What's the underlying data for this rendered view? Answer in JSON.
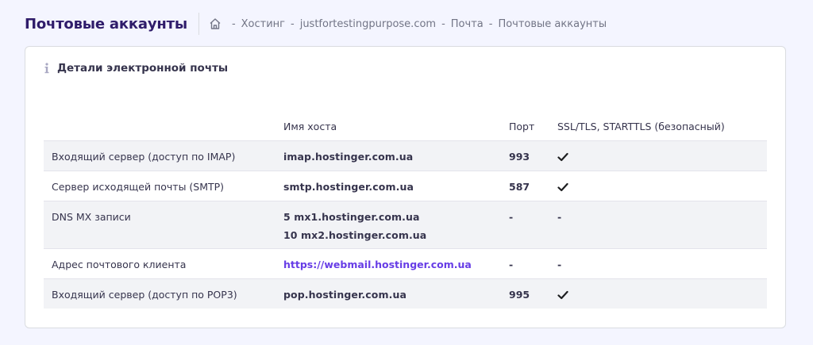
{
  "header": {
    "title": "Почтовые аккаунты",
    "breadcrumb": {
      "sep": "-",
      "items": [
        "Хостинг",
        "justfortestingpurpose.com",
        "Почта",
        "Почтовые аккаунты"
      ]
    }
  },
  "card": {
    "title": "Детали электронной почты"
  },
  "table": {
    "headers": {
      "service": "",
      "host": "Имя хоста",
      "port": "Порт",
      "ssl": "SSL/TLS, STARTTLS (безопасный)"
    },
    "rows": [
      {
        "service": "Входящий сервер (доступ по IMAP)",
        "host": "imap.hostinger.com.ua",
        "port": "993",
        "ssl": "check"
      },
      {
        "service": "Сервер исходящей почты (SMTP)",
        "host": "smtp.hostinger.com.ua",
        "port": "587",
        "ssl": "check"
      },
      {
        "service": "DNS MX записи",
        "host1": "5 mx1.hostinger.com.ua",
        "host2": "10 mx2.hostinger.com.ua",
        "port": "-",
        "ssl": "-"
      },
      {
        "service": "Адрес почтового клиента",
        "host": "https://webmail.hostinger.com.ua",
        "port": "-",
        "ssl": "-"
      },
      {
        "service": "Входящий сервер (доступ по POP3)",
        "host": "pop.hostinger.com.ua",
        "port": "995",
        "ssl": "check"
      }
    ]
  },
  "colors": {
    "accent": "#673de6",
    "title": "#2f1c6a",
    "background": "#f4f5ff"
  }
}
